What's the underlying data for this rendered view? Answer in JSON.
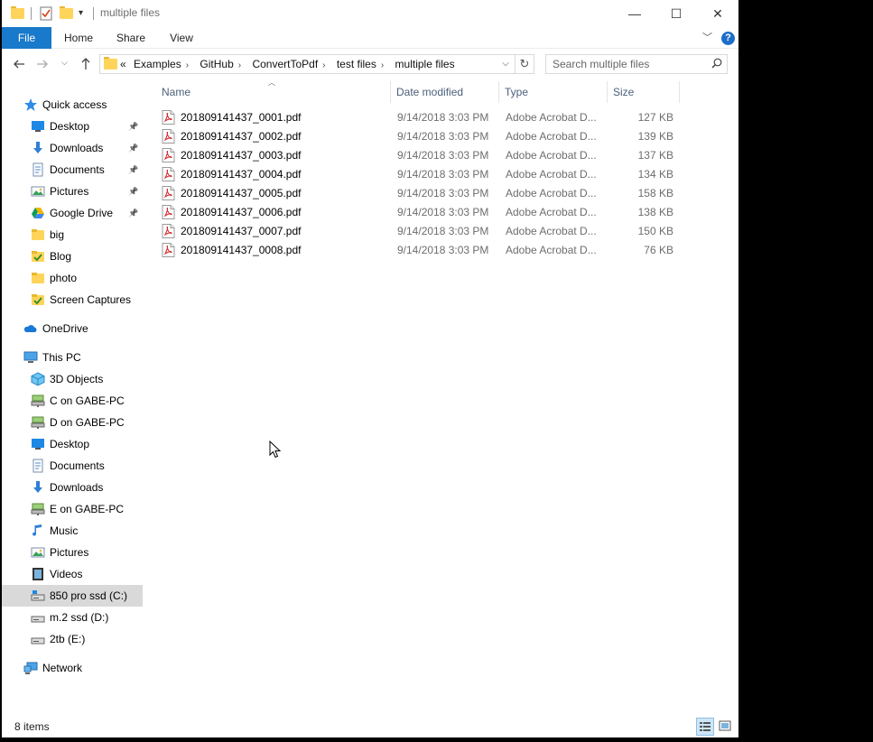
{
  "window": {
    "title": "multiple files",
    "minimize": "—",
    "maximize": "☐",
    "close": "✕"
  },
  "ribbon": {
    "tabs": [
      "File",
      "Home",
      "Share",
      "View"
    ],
    "help": "?"
  },
  "address": {
    "overflow": "«",
    "crumbs": [
      "Examples",
      "GitHub",
      "ConvertToPdf",
      "test files",
      "multiple files"
    ]
  },
  "search": {
    "placeholder": "Search multiple files"
  },
  "nav": {
    "quick_access": {
      "label": "Quick access"
    },
    "quick_items": [
      {
        "label": "Desktop",
        "icon": "desktop-icon",
        "pinned": true
      },
      {
        "label": "Downloads",
        "icon": "downloads-icon",
        "pinned": true
      },
      {
        "label": "Documents",
        "icon": "documents-icon",
        "pinned": true
      },
      {
        "label": "Pictures",
        "icon": "pictures-icon",
        "pinned": true
      },
      {
        "label": "Google Drive",
        "icon": "google-drive-icon",
        "pinned": true
      },
      {
        "label": "big",
        "icon": "folder-icon",
        "pinned": false
      },
      {
        "label": "Blog",
        "icon": "folder-check-icon",
        "pinned": false
      },
      {
        "label": "photo",
        "icon": "folder-icon",
        "pinned": false
      },
      {
        "label": "Screen Captures",
        "icon": "folder-check-icon",
        "pinned": false
      }
    ],
    "onedrive": {
      "label": "OneDrive"
    },
    "this_pc": {
      "label": "This PC"
    },
    "pc_items": [
      {
        "label": "3D Objects",
        "icon": "3d-objects-icon"
      },
      {
        "label": "C on GABE-PC",
        "icon": "network-drive-icon"
      },
      {
        "label": "D on GABE-PC",
        "icon": "network-drive-icon"
      },
      {
        "label": "Desktop",
        "icon": "desktop-icon"
      },
      {
        "label": "Documents",
        "icon": "documents-icon"
      },
      {
        "label": "Downloads",
        "icon": "downloads-icon"
      },
      {
        "label": "E on GABE-PC",
        "icon": "network-drive-icon"
      },
      {
        "label": "Music",
        "icon": "music-icon"
      },
      {
        "label": "Pictures",
        "icon": "pictures-icon"
      },
      {
        "label": "Videos",
        "icon": "videos-icon"
      },
      {
        "label": "850 pro ssd (C:)",
        "icon": "system-drive-icon",
        "selected": true
      },
      {
        "label": "m.2 ssd (D:)",
        "icon": "drive-icon"
      },
      {
        "label": "2tb (E:)",
        "icon": "drive-icon"
      }
    ],
    "network": {
      "label": "Network"
    }
  },
  "columns": [
    "Name",
    "Date modified",
    "Type",
    "Size"
  ],
  "files": [
    {
      "name": "201809141437_0001.pdf",
      "date": "9/14/2018 3:03 PM",
      "type": "Adobe Acrobat D...",
      "size": "127 KB"
    },
    {
      "name": "201809141437_0002.pdf",
      "date": "9/14/2018 3:03 PM",
      "type": "Adobe Acrobat D...",
      "size": "139 KB"
    },
    {
      "name": "201809141437_0003.pdf",
      "date": "9/14/2018 3:03 PM",
      "type": "Adobe Acrobat D...",
      "size": "137 KB"
    },
    {
      "name": "201809141437_0004.pdf",
      "date": "9/14/2018 3:03 PM",
      "type": "Adobe Acrobat D...",
      "size": "134 KB"
    },
    {
      "name": "201809141437_0005.pdf",
      "date": "9/14/2018 3:03 PM",
      "type": "Adobe Acrobat D...",
      "size": "158 KB"
    },
    {
      "name": "201809141437_0006.pdf",
      "date": "9/14/2018 3:03 PM",
      "type": "Adobe Acrobat D...",
      "size": "138 KB"
    },
    {
      "name": "201809141437_0007.pdf",
      "date": "9/14/2018 3:03 PM",
      "type": "Adobe Acrobat D...",
      "size": "150 KB"
    },
    {
      "name": "201809141437_0008.pdf",
      "date": "9/14/2018 3:03 PM",
      "type": "Adobe Acrobat D...",
      "size": "76 KB"
    }
  ],
  "status": {
    "count": "8 items"
  },
  "colors": {
    "accent": "#1979ca",
    "header_text": "#4c607a",
    "selected_bg": "#d9d9d9",
    "folder": "#ffd45a"
  }
}
